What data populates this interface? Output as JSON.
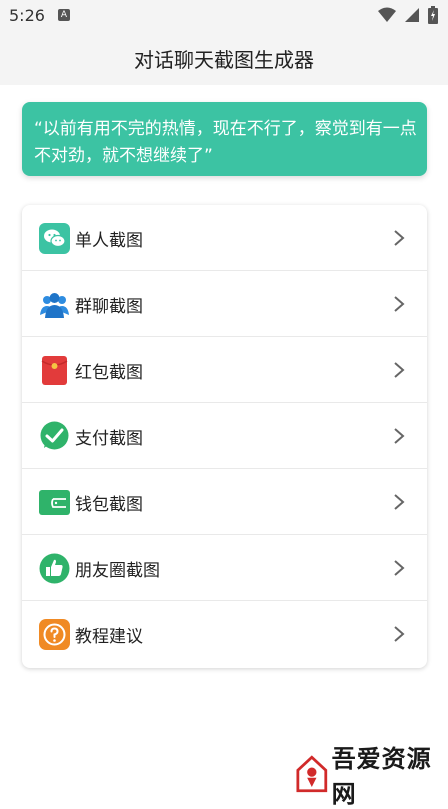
{
  "status_bar": {
    "time": "5:26",
    "notification_letter": "A"
  },
  "app_bar": {
    "title": "对话聊天截图生成器"
  },
  "quote": {
    "text": "“以前有用不完的热情，现在不行了，察觉到有一点不对劲，就不想继续了”"
  },
  "menu": {
    "items": [
      {
        "label": "单人截图",
        "icon": "wechat-icon"
      },
      {
        "label": "群聊截图",
        "icon": "group-icon"
      },
      {
        "label": "红包截图",
        "icon": "red-envelope-icon"
      },
      {
        "label": "支付截图",
        "icon": "payment-check-icon"
      },
      {
        "label": "钱包截图",
        "icon": "wallet-icon"
      },
      {
        "label": "朋友圈截图",
        "icon": "thumbs-up-icon"
      },
      {
        "label": "教程建议",
        "icon": "help-question-icon"
      }
    ]
  },
  "watermark": {
    "text": "吾爱资源网"
  },
  "colors": {
    "accent_teal": "#3cc3a3",
    "wechat_green": "#2fb36a",
    "red_envelope": "#e23b3b",
    "help_orange": "#f08a24",
    "group_blue": "#2e8ce0"
  }
}
